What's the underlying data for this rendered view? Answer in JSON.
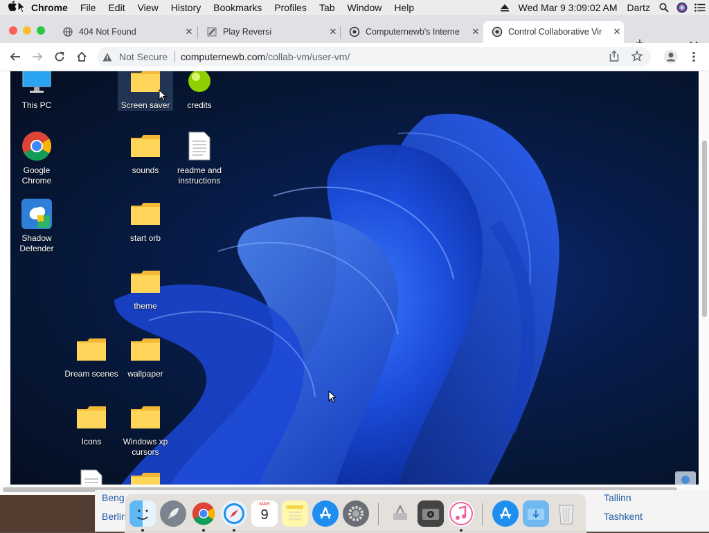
{
  "menubar": {
    "app": "Chrome",
    "items": [
      "File",
      "Edit",
      "View",
      "History",
      "Bookmarks",
      "Profiles",
      "Tab",
      "Window",
      "Help"
    ],
    "datetime": "Wed Mar 9  3:09:02 AM",
    "user": "Dartz"
  },
  "tabs": [
    {
      "title": "404 Not Found"
    },
    {
      "title": "Play Reversi"
    },
    {
      "title": "Computernewb's Interne"
    },
    {
      "title": "Control Collaborative Vir"
    }
  ],
  "address": {
    "security": "Not Secure",
    "host": "computernewb.com",
    "path": "/collab-vm/user-vm/"
  },
  "desktop": {
    "icons": [
      {
        "label": "This PC"
      },
      {
        "label": "Screen saver"
      },
      {
        "label": "credits"
      },
      {
        "label": "Google Chrome"
      },
      {
        "label": "sounds"
      },
      {
        "label": "readme and instructions"
      },
      {
        "label": "Shadow Defender"
      },
      {
        "label": "start orb"
      },
      {
        "label": "theme"
      },
      {
        "label": "Dream scenes"
      },
      {
        "label": "wallpaper"
      },
      {
        "label": "Icons"
      },
      {
        "label": "Windows xp cursors"
      }
    ]
  },
  "background_cells": [
    "Beng",
    "Berlin",
    "Tallinn",
    "Tashkent"
  ],
  "dock": {
    "apps": [
      "Finder",
      "Launchpad",
      "Google Chrome",
      "Safari",
      "Calendar",
      "Notes",
      "App Store",
      "System Preferences",
      "Utility",
      "Image Capture",
      "iTunes",
      "App Store",
      "Downloads",
      "Trash"
    ],
    "calendar_month": "MAR",
    "calendar_day": "9"
  },
  "colors": {
    "accent": "#1a73e8",
    "vm_bg": "#081d4e"
  }
}
